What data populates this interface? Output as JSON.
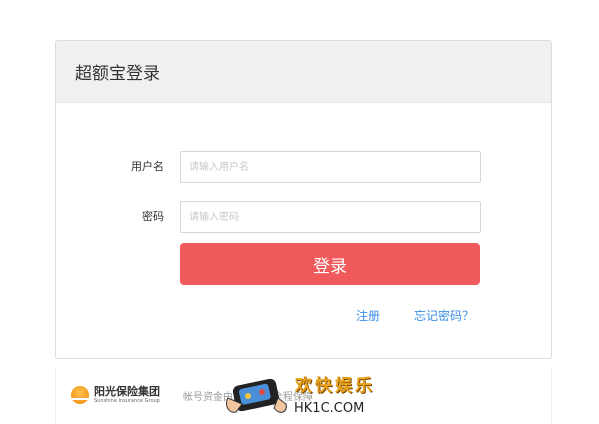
{
  "panel": {
    "title": "超额宝登录"
  },
  "form": {
    "username_label": "用户名",
    "username_placeholder": "请输入用户名",
    "password_label": "密码",
    "password_placeholder": "请输入密码",
    "login_button": "登录"
  },
  "links": {
    "register": "注册",
    "forgot_password": "忘记密码？"
  },
  "footer": {
    "brand_cn": "阳光保险集团",
    "brand_en": "Sunshine Insurance Group",
    "note": "帐号资金由阳光保险全程保障"
  },
  "watermark": {
    "title": "欢快娱乐",
    "url": "HK1C.COM"
  },
  "colors": {
    "accent": "#f05a5c",
    "link": "#3a8ee6",
    "header_bg": "#f0f0f0"
  }
}
